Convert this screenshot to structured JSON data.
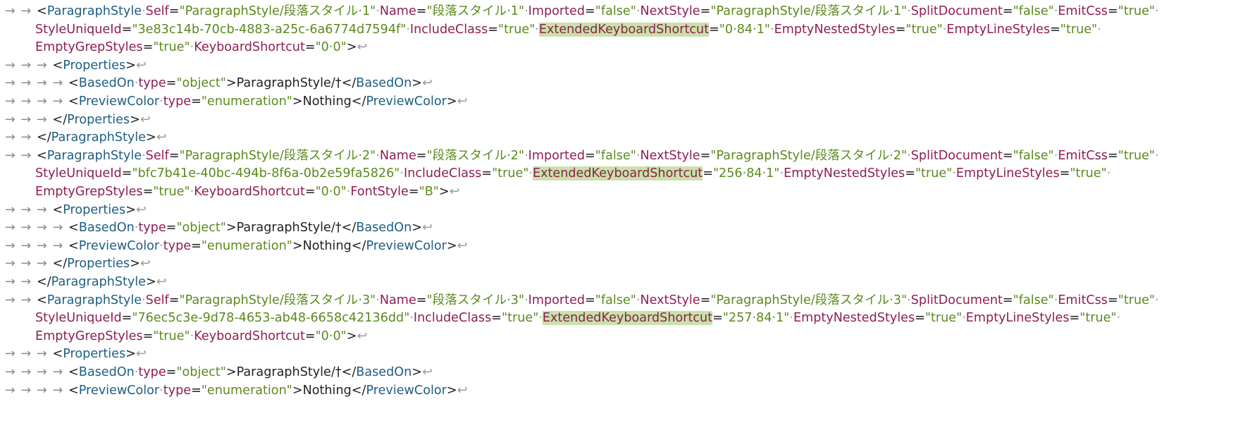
{
  "colors": {
    "background": "#ffffff",
    "tag": "#1f5e82",
    "attribute": "#8e1f52",
    "value": "#5b8a1e",
    "text": "#222222",
    "invisibles": "#9a9a9a",
    "highlight": "#c8e2a8"
  },
  "symbols": {
    "tab": "→",
    "space": "·",
    "return": "↩"
  },
  "lines": [
    {
      "indent": 2,
      "wrap": false,
      "tokens": [
        {
          "t": "p",
          "v": "<"
        },
        {
          "t": "tag",
          "v": "ParagraphStyle"
        },
        {
          "t": "sp"
        },
        {
          "t": "attr",
          "v": "Self"
        },
        {
          "t": "p",
          "v": "="
        },
        {
          "t": "val",
          "v": "\"ParagraphStyle/段落スタイル·1\""
        },
        {
          "t": "sp"
        },
        {
          "t": "attr",
          "v": "Name"
        },
        {
          "t": "p",
          "v": "="
        },
        {
          "t": "val",
          "v": "\"段落スタイル·1\""
        },
        {
          "t": "sp"
        },
        {
          "t": "attr",
          "v": "Imported"
        },
        {
          "t": "p",
          "v": "="
        },
        {
          "t": "val",
          "v": "\"false\""
        },
        {
          "t": "sp"
        },
        {
          "t": "attr",
          "v": "NextStyle"
        },
        {
          "t": "p",
          "v": "="
        },
        {
          "t": "val",
          "v": "\"ParagraphStyle/段落スタイル·1\""
        },
        {
          "t": "sp"
        },
        {
          "t": "attr",
          "v": "SplitDocument"
        },
        {
          "t": "p",
          "v": "="
        },
        {
          "t": "val",
          "v": "\"false\""
        },
        {
          "t": "sp"
        },
        {
          "t": "attr",
          "v": "EmitCss"
        },
        {
          "t": "p",
          "v": "="
        },
        {
          "t": "val",
          "v": "\"true\""
        },
        {
          "t": "sp"
        }
      ]
    },
    {
      "indent": 0,
      "wrap": true,
      "tokens": [
        {
          "t": "attr",
          "v": "StyleUniqueId"
        },
        {
          "t": "p",
          "v": "="
        },
        {
          "t": "val",
          "v": "\"3e83c14b-70cb-4883-a25c-6a6774d7594f\""
        },
        {
          "t": "sp"
        },
        {
          "t": "attr",
          "v": "IncludeClass"
        },
        {
          "t": "p",
          "v": "="
        },
        {
          "t": "val",
          "v": "\"true\""
        },
        {
          "t": "sp"
        },
        {
          "t": "attr",
          "v": "ExtendedKeyboardShortcut",
          "hl": true
        },
        {
          "t": "p",
          "v": "="
        },
        {
          "t": "val",
          "v": "\"0·84·1\""
        },
        {
          "t": "sp"
        },
        {
          "t": "attr",
          "v": "EmptyNestedStyles"
        },
        {
          "t": "p",
          "v": "="
        },
        {
          "t": "val",
          "v": "\"true\""
        },
        {
          "t": "sp"
        },
        {
          "t": "attr",
          "v": "EmptyLineStyles"
        },
        {
          "t": "p",
          "v": "="
        },
        {
          "t": "val",
          "v": "\"true\""
        },
        {
          "t": "sp"
        }
      ]
    },
    {
      "indent": 0,
      "wrap": true,
      "tokens": [
        {
          "t": "attr",
          "v": "EmptyGrepStyles"
        },
        {
          "t": "p",
          "v": "="
        },
        {
          "t": "val",
          "v": "\"true\""
        },
        {
          "t": "sp"
        },
        {
          "t": "attr",
          "v": "KeyboardShortcut"
        },
        {
          "t": "p",
          "v": "="
        },
        {
          "t": "val",
          "v": "\"0·0\""
        },
        {
          "t": "p",
          "v": ">"
        },
        {
          "t": "ret"
        }
      ]
    },
    {
      "indent": 3,
      "wrap": false,
      "tokens": [
        {
          "t": "p",
          "v": "<"
        },
        {
          "t": "tag",
          "v": "Properties"
        },
        {
          "t": "p",
          "v": ">"
        },
        {
          "t": "ret"
        }
      ]
    },
    {
      "indent": 4,
      "wrap": false,
      "tokens": [
        {
          "t": "p",
          "v": "<"
        },
        {
          "t": "tag",
          "v": "BasedOn"
        },
        {
          "t": "sp"
        },
        {
          "t": "attr",
          "v": "type"
        },
        {
          "t": "p",
          "v": "="
        },
        {
          "t": "val",
          "v": "\"object\""
        },
        {
          "t": "p",
          "v": ">"
        },
        {
          "t": "txt",
          "v": "ParagraphStyle/†"
        },
        {
          "t": "p",
          "v": "</"
        },
        {
          "t": "tag",
          "v": "BasedOn"
        },
        {
          "t": "p",
          "v": ">"
        },
        {
          "t": "ret"
        }
      ]
    },
    {
      "indent": 4,
      "wrap": false,
      "tokens": [
        {
          "t": "p",
          "v": "<"
        },
        {
          "t": "tag",
          "v": "PreviewColor"
        },
        {
          "t": "sp"
        },
        {
          "t": "attr",
          "v": "type"
        },
        {
          "t": "p",
          "v": "="
        },
        {
          "t": "val",
          "v": "\"enumeration\""
        },
        {
          "t": "p",
          "v": ">"
        },
        {
          "t": "txt",
          "v": "Nothing"
        },
        {
          "t": "p",
          "v": "</"
        },
        {
          "t": "tag",
          "v": "PreviewColor"
        },
        {
          "t": "p",
          "v": ">"
        },
        {
          "t": "ret"
        }
      ]
    },
    {
      "indent": 3,
      "wrap": false,
      "tokens": [
        {
          "t": "p",
          "v": "</"
        },
        {
          "t": "tag",
          "v": "Properties"
        },
        {
          "t": "p",
          "v": ">"
        },
        {
          "t": "ret"
        }
      ]
    },
    {
      "indent": 2,
      "wrap": false,
      "tokens": [
        {
          "t": "p",
          "v": "</"
        },
        {
          "t": "tag",
          "v": "ParagraphStyle"
        },
        {
          "t": "p",
          "v": ">"
        },
        {
          "t": "ret"
        }
      ]
    },
    {
      "indent": 2,
      "wrap": false,
      "tokens": [
        {
          "t": "p",
          "v": "<"
        },
        {
          "t": "tag",
          "v": "ParagraphStyle"
        },
        {
          "t": "sp"
        },
        {
          "t": "attr",
          "v": "Self"
        },
        {
          "t": "p",
          "v": "="
        },
        {
          "t": "val",
          "v": "\"ParagraphStyle/段落スタイル·2\""
        },
        {
          "t": "sp"
        },
        {
          "t": "attr",
          "v": "Name"
        },
        {
          "t": "p",
          "v": "="
        },
        {
          "t": "val",
          "v": "\"段落スタイル·2\""
        },
        {
          "t": "sp"
        },
        {
          "t": "attr",
          "v": "Imported"
        },
        {
          "t": "p",
          "v": "="
        },
        {
          "t": "val",
          "v": "\"false\""
        },
        {
          "t": "sp"
        },
        {
          "t": "attr",
          "v": "NextStyle"
        },
        {
          "t": "p",
          "v": "="
        },
        {
          "t": "val",
          "v": "\"ParagraphStyle/段落スタイル·2\""
        },
        {
          "t": "sp"
        },
        {
          "t": "attr",
          "v": "SplitDocument"
        },
        {
          "t": "p",
          "v": "="
        },
        {
          "t": "val",
          "v": "\"false\""
        },
        {
          "t": "sp"
        },
        {
          "t": "attr",
          "v": "EmitCss"
        },
        {
          "t": "p",
          "v": "="
        },
        {
          "t": "val",
          "v": "\"true\""
        },
        {
          "t": "sp"
        }
      ]
    },
    {
      "indent": 0,
      "wrap": true,
      "tokens": [
        {
          "t": "attr",
          "v": "StyleUniqueId"
        },
        {
          "t": "p",
          "v": "="
        },
        {
          "t": "val",
          "v": "\"bfc7b41e-40bc-494b-8f6a-0b2e59fa5826\""
        },
        {
          "t": "sp"
        },
        {
          "t": "attr",
          "v": "IncludeClass"
        },
        {
          "t": "p",
          "v": "="
        },
        {
          "t": "val",
          "v": "\"true\""
        },
        {
          "t": "sp"
        },
        {
          "t": "attr",
          "v": "ExtendedKeyboardShortcut",
          "hl": true
        },
        {
          "t": "p",
          "v": "="
        },
        {
          "t": "val",
          "v": "\"256·84·1\""
        },
        {
          "t": "sp"
        },
        {
          "t": "attr",
          "v": "EmptyNestedStyles"
        },
        {
          "t": "p",
          "v": "="
        },
        {
          "t": "val",
          "v": "\"true\""
        },
        {
          "t": "sp"
        },
        {
          "t": "attr",
          "v": "EmptyLineStyles"
        },
        {
          "t": "p",
          "v": "="
        },
        {
          "t": "val",
          "v": "\"true\""
        },
        {
          "t": "sp"
        }
      ]
    },
    {
      "indent": 0,
      "wrap": true,
      "tokens": [
        {
          "t": "attr",
          "v": "EmptyGrepStyles"
        },
        {
          "t": "p",
          "v": "="
        },
        {
          "t": "val",
          "v": "\"true\""
        },
        {
          "t": "sp"
        },
        {
          "t": "attr",
          "v": "KeyboardShortcut"
        },
        {
          "t": "p",
          "v": "="
        },
        {
          "t": "val",
          "v": "\"0·0\""
        },
        {
          "t": "sp"
        },
        {
          "t": "attr",
          "v": "FontStyle"
        },
        {
          "t": "p",
          "v": "="
        },
        {
          "t": "val",
          "v": "\"B\""
        },
        {
          "t": "p",
          "v": ">"
        },
        {
          "t": "ret"
        }
      ]
    },
    {
      "indent": 3,
      "wrap": false,
      "tokens": [
        {
          "t": "p",
          "v": "<"
        },
        {
          "t": "tag",
          "v": "Properties"
        },
        {
          "t": "p",
          "v": ">"
        },
        {
          "t": "ret"
        }
      ]
    },
    {
      "indent": 4,
      "wrap": false,
      "tokens": [
        {
          "t": "p",
          "v": "<"
        },
        {
          "t": "tag",
          "v": "BasedOn"
        },
        {
          "t": "sp"
        },
        {
          "t": "attr",
          "v": "type"
        },
        {
          "t": "p",
          "v": "="
        },
        {
          "t": "val",
          "v": "\"object\""
        },
        {
          "t": "p",
          "v": ">"
        },
        {
          "t": "txt",
          "v": "ParagraphStyle/†"
        },
        {
          "t": "p",
          "v": "</"
        },
        {
          "t": "tag",
          "v": "BasedOn"
        },
        {
          "t": "p",
          "v": ">"
        },
        {
          "t": "ret"
        }
      ]
    },
    {
      "indent": 4,
      "wrap": false,
      "tokens": [
        {
          "t": "p",
          "v": "<"
        },
        {
          "t": "tag",
          "v": "PreviewColor"
        },
        {
          "t": "sp"
        },
        {
          "t": "attr",
          "v": "type"
        },
        {
          "t": "p",
          "v": "="
        },
        {
          "t": "val",
          "v": "\"enumeration\""
        },
        {
          "t": "p",
          "v": ">"
        },
        {
          "t": "txt",
          "v": "Nothing"
        },
        {
          "t": "p",
          "v": "</"
        },
        {
          "t": "tag",
          "v": "PreviewColor"
        },
        {
          "t": "p",
          "v": ">"
        },
        {
          "t": "ret"
        }
      ]
    },
    {
      "indent": 3,
      "wrap": false,
      "tokens": [
        {
          "t": "p",
          "v": "</"
        },
        {
          "t": "tag",
          "v": "Properties"
        },
        {
          "t": "p",
          "v": ">"
        },
        {
          "t": "ret"
        }
      ]
    },
    {
      "indent": 2,
      "wrap": false,
      "tokens": [
        {
          "t": "p",
          "v": "</"
        },
        {
          "t": "tag",
          "v": "ParagraphStyle"
        },
        {
          "t": "p",
          "v": ">"
        },
        {
          "t": "ret"
        }
      ]
    },
    {
      "indent": 2,
      "wrap": false,
      "tokens": [
        {
          "t": "p",
          "v": "<"
        },
        {
          "t": "tag",
          "v": "ParagraphStyle"
        },
        {
          "t": "sp"
        },
        {
          "t": "attr",
          "v": "Self"
        },
        {
          "t": "p",
          "v": "="
        },
        {
          "t": "val",
          "v": "\"ParagraphStyle/段落スタイル·3\""
        },
        {
          "t": "sp"
        },
        {
          "t": "attr",
          "v": "Name"
        },
        {
          "t": "p",
          "v": "="
        },
        {
          "t": "val",
          "v": "\"段落スタイル·3\""
        },
        {
          "t": "sp"
        },
        {
          "t": "attr",
          "v": "Imported"
        },
        {
          "t": "p",
          "v": "="
        },
        {
          "t": "val",
          "v": "\"false\""
        },
        {
          "t": "sp"
        },
        {
          "t": "attr",
          "v": "NextStyle"
        },
        {
          "t": "p",
          "v": "="
        },
        {
          "t": "val",
          "v": "\"ParagraphStyle/段落スタイル·3\""
        },
        {
          "t": "sp"
        },
        {
          "t": "attr",
          "v": "SplitDocument"
        },
        {
          "t": "p",
          "v": "="
        },
        {
          "t": "val",
          "v": "\"false\""
        },
        {
          "t": "sp"
        },
        {
          "t": "attr",
          "v": "EmitCss"
        },
        {
          "t": "p",
          "v": "="
        },
        {
          "t": "val",
          "v": "\"true\""
        },
        {
          "t": "sp"
        }
      ]
    },
    {
      "indent": 0,
      "wrap": true,
      "tokens": [
        {
          "t": "attr",
          "v": "StyleUniqueId"
        },
        {
          "t": "p",
          "v": "="
        },
        {
          "t": "val",
          "v": "\"76ec5c3e-9d78-4653-ab48-6658c42136dd\""
        },
        {
          "t": "sp"
        },
        {
          "t": "attr",
          "v": "IncludeClass"
        },
        {
          "t": "p",
          "v": "="
        },
        {
          "t": "val",
          "v": "\"true\""
        },
        {
          "t": "sp"
        },
        {
          "t": "attr",
          "v": "ExtendedKeyboardShortcut",
          "hl": true
        },
        {
          "t": "p",
          "v": "="
        },
        {
          "t": "val",
          "v": "\"257·84·1\""
        },
        {
          "t": "sp"
        },
        {
          "t": "attr",
          "v": "EmptyNestedStyles"
        },
        {
          "t": "p",
          "v": "="
        },
        {
          "t": "val",
          "v": "\"true\""
        },
        {
          "t": "sp"
        },
        {
          "t": "attr",
          "v": "EmptyLineStyles"
        },
        {
          "t": "p",
          "v": "="
        },
        {
          "t": "val",
          "v": "\"true\""
        },
        {
          "t": "sp"
        }
      ]
    },
    {
      "indent": 0,
      "wrap": true,
      "tokens": [
        {
          "t": "attr",
          "v": "EmptyGrepStyles"
        },
        {
          "t": "p",
          "v": "="
        },
        {
          "t": "val",
          "v": "\"true\""
        },
        {
          "t": "sp"
        },
        {
          "t": "attr",
          "v": "KeyboardShortcut"
        },
        {
          "t": "p",
          "v": "="
        },
        {
          "t": "val",
          "v": "\"0·0\""
        },
        {
          "t": "p",
          "v": ">"
        },
        {
          "t": "ret"
        }
      ]
    },
    {
      "indent": 3,
      "wrap": false,
      "tokens": [
        {
          "t": "p",
          "v": "<"
        },
        {
          "t": "tag",
          "v": "Properties"
        },
        {
          "t": "p",
          "v": ">"
        },
        {
          "t": "ret"
        }
      ]
    },
    {
      "indent": 4,
      "wrap": false,
      "tokens": [
        {
          "t": "p",
          "v": "<"
        },
        {
          "t": "tag",
          "v": "BasedOn"
        },
        {
          "t": "sp"
        },
        {
          "t": "attr",
          "v": "type"
        },
        {
          "t": "p",
          "v": "="
        },
        {
          "t": "val",
          "v": "\"object\""
        },
        {
          "t": "p",
          "v": ">"
        },
        {
          "t": "txt",
          "v": "ParagraphStyle/†"
        },
        {
          "t": "p",
          "v": "</"
        },
        {
          "t": "tag",
          "v": "BasedOn"
        },
        {
          "t": "p",
          "v": ">"
        },
        {
          "t": "ret"
        }
      ]
    },
    {
      "indent": 4,
      "wrap": false,
      "tokens": [
        {
          "t": "p",
          "v": "<"
        },
        {
          "t": "tag",
          "v": "PreviewColor"
        },
        {
          "t": "sp"
        },
        {
          "t": "attr",
          "v": "type"
        },
        {
          "t": "p",
          "v": "="
        },
        {
          "t": "val",
          "v": "\"enumeration\""
        },
        {
          "t": "p",
          "v": ">"
        },
        {
          "t": "txt",
          "v": "Nothing"
        },
        {
          "t": "p",
          "v": "</"
        },
        {
          "t": "tag",
          "v": "PreviewColor"
        },
        {
          "t": "p",
          "v": ">"
        },
        {
          "t": "ret"
        }
      ]
    }
  ]
}
